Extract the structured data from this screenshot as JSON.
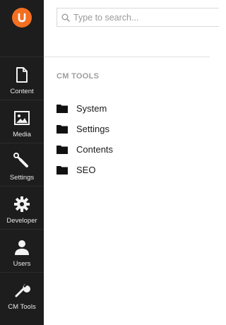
{
  "sidebar": {
    "logo_icon": "umbraco-logo-icon",
    "accent": "#f36f21",
    "items": [
      {
        "label": "Content",
        "icon": "document-icon"
      },
      {
        "label": "Media",
        "icon": "image-icon"
      },
      {
        "label": "Settings",
        "icon": "wrench-icon"
      },
      {
        "label": "Developer",
        "icon": "gear-icon"
      },
      {
        "label": "Users",
        "icon": "user-icon"
      },
      {
        "label": "CM Tools",
        "icon": "tools-icon"
      }
    ]
  },
  "search": {
    "placeholder": "Type to search...",
    "value": ""
  },
  "section": {
    "title": "CM TOOLS"
  },
  "tree": {
    "items": [
      {
        "label": "System",
        "icon": "folder-icon"
      },
      {
        "label": "Settings",
        "icon": "folder-icon"
      },
      {
        "label": "Contents",
        "icon": "folder-icon"
      },
      {
        "label": "SEO",
        "icon": "folder-icon"
      }
    ]
  }
}
